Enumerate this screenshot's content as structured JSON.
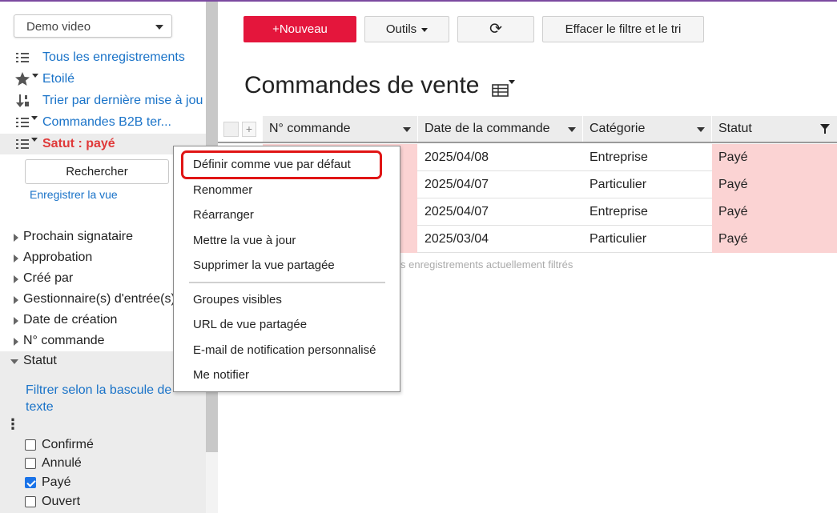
{
  "sidebar": {
    "view_select": "Demo video",
    "nav": [
      {
        "label": "Tous les enregistrements",
        "icon": "list-icon"
      },
      {
        "label": "Etoilé",
        "icon": "star-icon"
      },
      {
        "label": "Trier par dernière mise à jou",
        "icon": "sort-icon"
      },
      {
        "label": "Commandes B2B ter...",
        "icon": "list-icon"
      },
      {
        "label": "Satut : payé",
        "icon": "list-icon"
      }
    ],
    "search_label": "Rechercher",
    "save_view_label": "Enregistrer la vue",
    "fields": [
      "Prochain signataire",
      "Approbation",
      "Créé par",
      "Gestionnaire(s) d'entrée(s)",
      "Date de création",
      "N° commande",
      "Statut"
    ],
    "filter_toggle_label": "Filtrer selon la bascule de texte",
    "status_options": [
      {
        "label": "Confirmé",
        "checked": false
      },
      {
        "label": "Annulé",
        "checked": false
      },
      {
        "label": "Payé",
        "checked": true
      },
      {
        "label": "Ouvert",
        "checked": false
      }
    ]
  },
  "toolbar": {
    "new_label": "+Nouveau",
    "tools_label": "Outils",
    "refresh_icon": "⟳",
    "clear_label": "Effacer le filtre et le tri"
  },
  "main": {
    "title": "Commandes de vente",
    "columns": [
      "N° commande",
      "Date de la commande",
      "Catégorie",
      "Statut"
    ],
    "rows": [
      {
        "date": "2025/04/08",
        "category": "Entreprise",
        "status": "Payé"
      },
      {
        "date": "2025/04/07",
        "category": "Particulier",
        "status": "Payé"
      },
      {
        "date": "2025/04/07",
        "category": "Entreprise",
        "status": "Payé"
      },
      {
        "date": "2025/03/04",
        "category": "Particulier",
        "status": "Payé"
      }
    ],
    "footer_note": "s enregistrements actuellement filtrés"
  },
  "context_menu": {
    "items": [
      "Définir comme vue par défaut",
      "Renommer",
      "Réarranger",
      "Mettre la vue à jour",
      "Supprimer la vue partagée",
      "Groupes visibles",
      "URL de vue partagée",
      "E-mail de notification personnalisé",
      "Me notifier"
    ]
  },
  "colors": {
    "primary": "#e4163c",
    "link": "#1a73c8",
    "active_red": "#e03a3a",
    "status_bg": "#fbd3d3",
    "highlight": "#e01515"
  }
}
